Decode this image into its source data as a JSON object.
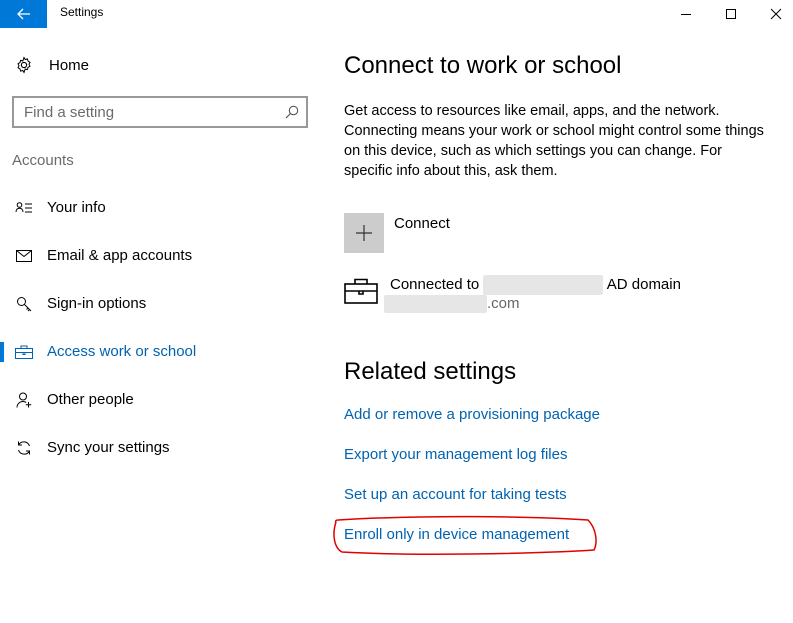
{
  "window": {
    "title": "Settings",
    "controls": [
      "minimize",
      "maximize",
      "close"
    ]
  },
  "sidebar": {
    "home_label": "Home",
    "search_placeholder": "Find a setting",
    "section_label": "Accounts",
    "items": [
      {
        "label": "Your info",
        "icon": "person-card-icon"
      },
      {
        "label": "Email & app accounts",
        "icon": "mail-icon"
      },
      {
        "label": "Sign-in options",
        "icon": "key-icon"
      },
      {
        "label": "Access work or school",
        "icon": "briefcase-icon",
        "selected": true
      },
      {
        "label": "Other people",
        "icon": "person-add-icon"
      },
      {
        "label": "Sync your settings",
        "icon": "sync-icon"
      }
    ]
  },
  "main": {
    "title": "Connect to work or school",
    "description": "Get access to resources like email, apps, and the network. Connecting means your work or school might control some things on this device, such as which settings you can change. For specific info about this, ask them.",
    "connect_label": "Connect",
    "account": {
      "prefix": "Connected to",
      "suffix": "AD domain",
      "domain_suffix": ".com"
    },
    "related_heading": "Related settings",
    "links": [
      "Add or remove a provisioning package",
      "Export your management log files",
      "Set up an account for taking tests",
      "Enroll only in device management"
    ]
  },
  "colors": {
    "accent": "#0078d7",
    "link": "#0063b1",
    "annotation": "#e00000"
  }
}
